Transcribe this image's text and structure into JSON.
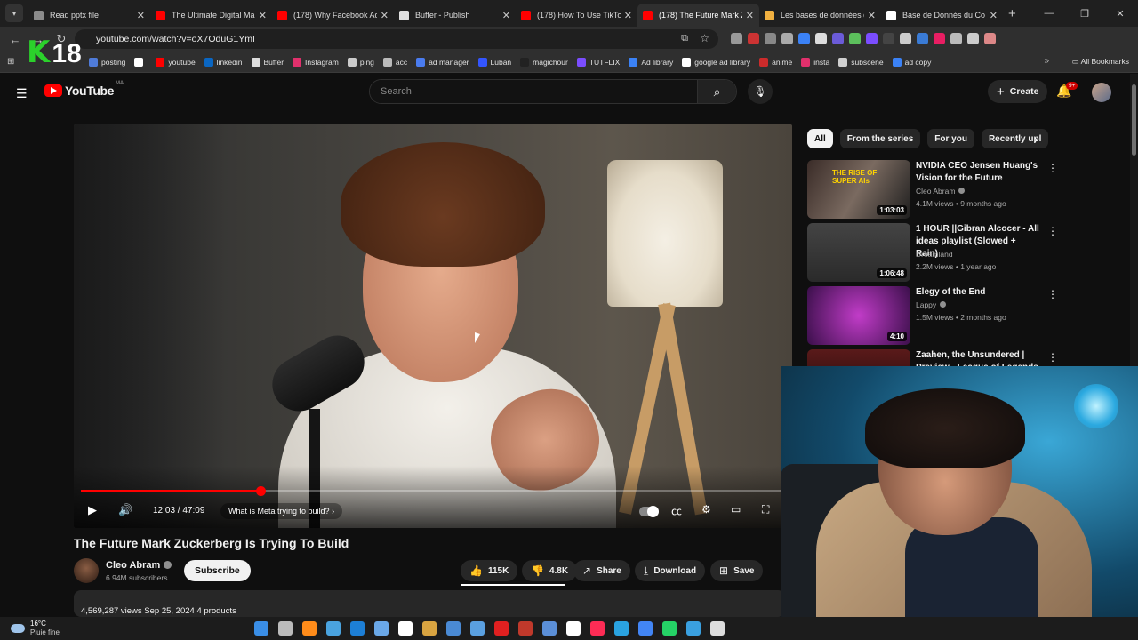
{
  "browser": {
    "tabs": [
      {
        "label": "Read pptx file",
        "color": "#8a8a8a",
        "active": false
      },
      {
        "label": "The Ultimate Digital Ma",
        "color": "#ff0000",
        "active": false
      },
      {
        "label": "(178) Why Facebook Ad",
        "color": "#ff0000",
        "active": false
      },
      {
        "label": "Buffer - Publish",
        "color": "#e0e0e0",
        "active": false
      },
      {
        "label": "(178) How To Use TikTo",
        "color": "#ff0000",
        "active": false
      },
      {
        "label": "(178) The Future Mark Z",
        "color": "#ff0000",
        "active": true
      },
      {
        "label": "Les bases de données d",
        "color": "#f0b040",
        "active": false
      },
      {
        "label": "Base de Donnés du Co",
        "color": "#ffffff",
        "active": false
      }
    ],
    "url": "youtube.com/watch?v=oX7OduG1YmI",
    "bookmarks": [
      {
        "label": "posting",
        "color": "#4f7bd8"
      },
      {
        "label": "",
        "color": "#ffffff"
      },
      {
        "label": "youtube",
        "color": "#ff0000"
      },
      {
        "label": "linkedin",
        "color": "#0a66c2"
      },
      {
        "label": "Buffer",
        "color": "#dddddd"
      },
      {
        "label": "Instagram",
        "color": "#e1306c"
      },
      {
        "label": "ping",
        "color": "#cccccc"
      },
      {
        "label": "acc",
        "color": "#bbbbbb"
      },
      {
        "label": "ad manager",
        "color": "#4a7cf0"
      },
      {
        "label": "Luban",
        "color": "#3355ff"
      },
      {
        "label": "magichour",
        "color": "#222222"
      },
      {
        "label": "TUTFLIX",
        "color": "#7b4dff"
      },
      {
        "label": "Ad library",
        "color": "#3b82f6"
      },
      {
        "label": "google ad library",
        "color": "#ffffff"
      },
      {
        "label": "anime",
        "color": "#cc2b2b"
      },
      {
        "label": "insta",
        "color": "#e1306c"
      },
      {
        "label": "subscene",
        "color": "#cfcfcf"
      },
      {
        "label": "ad copy",
        "color": "#3b82f6"
      }
    ],
    "all_bookmarks": "All Bookmarks",
    "overlay_k": "K",
    "overlay_num": "18"
  },
  "youtube": {
    "logo": "YouTube",
    "country": "MA",
    "search_placeholder": "Search",
    "create_label": "Create",
    "notif_count": "9+"
  },
  "video": {
    "current_time": "12:03 / 47:09",
    "chapter": "What is Meta trying to build?",
    "progress": 0.255,
    "title": "The Future Mark Zuckerberg Is Trying To Build",
    "channel": "Cleo Abram",
    "subscribers": "6.94M subscribers",
    "subscribe_label": "Subscribe",
    "likes": "115K",
    "dislikes": "4.8K",
    "share_label": "Share",
    "download_label": "Download",
    "save_label": "Save",
    "meta_line": "4,569,287 views  Sep 25, 2024  4 products"
  },
  "sidebar": {
    "chips": [
      "All",
      "From the series",
      "For you",
      "Recently upl"
    ],
    "recommendations": [
      {
        "title": "NVIDIA CEO Jensen Huang's Vision for the Future",
        "channel": "Cleo Abram",
        "verified": true,
        "views": "4.1M views • 9 months ago",
        "duration": "1:03:03",
        "thumb_text": "THE RISE OF SUPER AIs"
      },
      {
        "title": "1 HOUR ||Gibran Alcocer - All ideas playlist (Slowed + Rain)",
        "channel": "Dreamland",
        "verified": false,
        "views": "2.2M views • 1 year ago",
        "duration": "1:06:48",
        "thumb_text": ""
      },
      {
        "title": "Elegy of the End",
        "channel": "Lappy",
        "verified": true,
        "views": "1.5M views • 2 months ago",
        "duration": "4:10",
        "thumb_text": ""
      },
      {
        "title": "Zaahen, the Unsundered | Preview - League of Legends",
        "channel": "",
        "verified": false,
        "views": "",
        "duration": "",
        "thumb_text": ""
      }
    ]
  },
  "taskbar": {
    "temp": "16°C",
    "weather": "Pluie fine",
    "icons": [
      "#3a8ee6",
      "#bbbbbb",
      "#ff8c1a",
      "#4aa3df",
      "#1d7fd6",
      "#6aa8e8",
      "#ffffff",
      "#d9a441",
      "#4a8ad4",
      "#5aa0e0",
      "#e02020",
      "#c0392b",
      "#5b8fd8",
      "#ffffff",
      "#fe2c55",
      "#2aa3e0",
      "#4285f4",
      "#25d366",
      "#3aa0e0",
      "#dddddd"
    ]
  }
}
